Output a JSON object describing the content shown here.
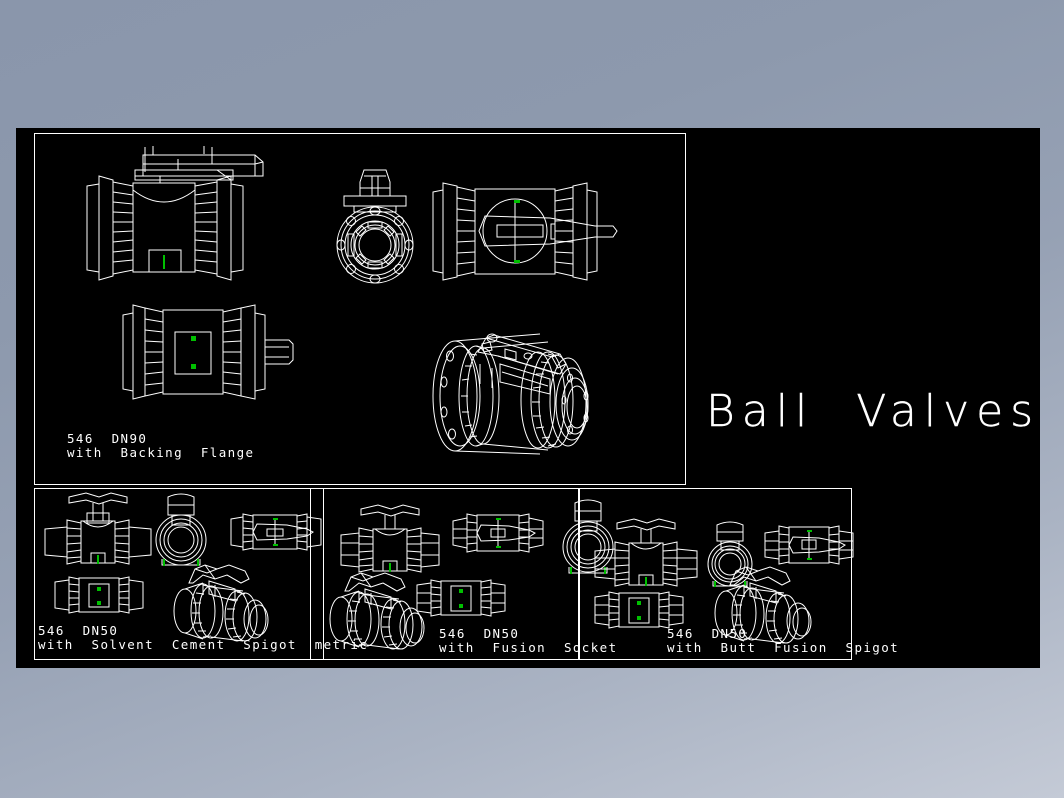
{
  "document": {
    "type": "cad-drawing",
    "title": "Ball Valves",
    "background_color": "#8d99ad",
    "canvas_color": "#000000",
    "line_color": "#ffffff",
    "node_marker_color": "#00c000"
  },
  "title_block": {
    "text": "Ball  Valves"
  },
  "panels": [
    {
      "id": "main",
      "name": "main-viewport",
      "label_line1": "546  DN90",
      "label_line2": "with  Backing  Flange",
      "views": [
        {
          "name": "front-elevation-view",
          "description": "546 DN90 ball valve front elevation with lever handle and backing flanges"
        },
        {
          "name": "end-axial-view",
          "description": "Axial end view showing bore and flange bolt circle"
        },
        {
          "name": "plan-view-handle",
          "description": "Plan view showing lever handle and stem"
        },
        {
          "name": "bottom-plan-view",
          "description": "Plan view with body insert plate"
        },
        {
          "name": "isometric-3d-view",
          "description": "3D isometric rendering of DN90 ball valve with backing flange"
        }
      ]
    },
    {
      "id": "solvent-cement",
      "name": "solvent-cement-viewport",
      "label_line1": "546  DN50",
      "label_line2": "with  Solvent  Cement  Spigot  metric",
      "views": [
        {
          "name": "front-elevation-view",
          "description": "Front elevation with T-handle"
        },
        {
          "name": "end-axial-view",
          "description": "Axial end view"
        },
        {
          "name": "plan-view-handle",
          "description": "Plan view with handle"
        },
        {
          "name": "bottom-plan-view",
          "description": "Bottom plan view"
        },
        {
          "name": "isometric-3d-view",
          "description": "3D isometric rendering"
        }
      ]
    },
    {
      "id": "fusion-socket",
      "name": "fusion-socket-viewport",
      "label_line1": "546  DN50",
      "label_line2": "with  Fusion  Socket",
      "views": [
        {
          "name": "front-elevation-view",
          "description": "Front elevation with T-handle"
        },
        {
          "name": "plan-view-handle",
          "description": "Plan view with handle"
        },
        {
          "name": "end-axial-view",
          "description": "Axial end view"
        },
        {
          "name": "isometric-3d-view",
          "description": "3D isometric rendering"
        },
        {
          "name": "bottom-plan-view",
          "description": "Bottom plan view"
        }
      ]
    },
    {
      "id": "butt-fusion",
      "name": "butt-fusion-viewport",
      "label_line1": "546  DN50",
      "label_line2": "with  Butt  Fusion  Spigot",
      "views": [
        {
          "name": "front-elevation-view",
          "description": "Front elevation with T-handle"
        },
        {
          "name": "end-axial-view",
          "description": "Axial end view"
        },
        {
          "name": "plan-view-handle",
          "description": "Plan view with handle"
        },
        {
          "name": "bottom-plan-view",
          "description": "Bottom plan view"
        },
        {
          "name": "isometric-3d-view",
          "description": "3D isometric rendering"
        }
      ]
    }
  ]
}
